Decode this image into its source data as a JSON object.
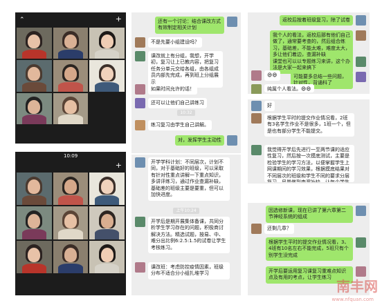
{
  "panel_tl": {
    "collapse_icon": "chevron-up-icon",
    "add_icon": "plus-icon",
    "participants": 8
  },
  "panel_tm": {
    "messages": [
      "还有一个讨论：结合课改方式有效制定相关计划",
      "不是先要小组建设吗？",
      "课改就上有分组，我想，开学初，复习让上已教内容，把复习任务分单元交给各组，由各组成员内部先完成，再到班上分组展示",
      "如果时间允许的话！",
      "还可以让他们自己讲练习",
      "练习复习由学生自己讲解。",
      "对，发挥学生主动性"
    ],
    "time_label": "10:32"
  },
  "panel_tr": {
    "messages": [
      "返校后按着班级复习，除了试卷",
      "我个人的看法，返校后那有他们自己做了，通常要考查的，然后组合练习，基础差，不能太难，难度太大，多让他们着边，查漏补缺",
      "课堂也可以以专题练习来讲，这个办法是大家一起来搞下",
      "😄😄",
      "可能要多总结一些问题，针对性，背诵科了",
      "👍👍",
      "纯属个人看法。😄😄"
    ]
  },
  "panel_mr": {
    "messages": [
      "好",
      "根据学生平时的提交作业情况看，2班有3名学生作业不是很多，1班一个，但是也有部分学生不能提交。",
      "我觉得开学后先进行一至两节课的适应性复习，然后按一次摸底测试，主要是检验学生的学习方法，以便掌握学生上网课期间的学习效果，根据摸底结果对不同层次的班级和学生不同的要求分层复习，尽量做到查漏补缺，让每个学生都能掌握基本的知识，会做基本的题目。"
    ]
  },
  "panel_bl": {
    "status_time": "10:09",
    "add_icon": "plus-icon",
    "participants": 9
  },
  "panel_bm": {
    "messages": [
      "开学学科计划：不同层次，计划不同，对于基础好的班级，可以采取有针对性重点讲解一下重点知识，多讲评练习，通过作业查漏补缺，基础差的班级主要是要重，但可以加快进度。",
      "开学后是期开展集体备课，共同分析学生学习存在的问题，积极商讨解决方法。精选试题，按易、中、难分出比例6:2.5:1.5的试卷让学生考核练习。",
      "课改班：考虑防控疫情因素，班级分布不适合分小组扎堆学习"
    ],
    "time_label": "上午10:24"
  },
  "panel_br": {
    "messages": [
      "因选修新课，现在已讲了第六章第二节神经系统的组成",
      "还剩几章？",
      "根据学生平时的提交作业情况看，3、4班有10名左右不能完成，5班只有个别学生没完成",
      "开学后要运用复习课复习重难点知识点及有用的考点，让学生练习"
    ]
  },
  "watermark": {
    "text": "南丰网",
    "url": "www.nfquan.com"
  }
}
